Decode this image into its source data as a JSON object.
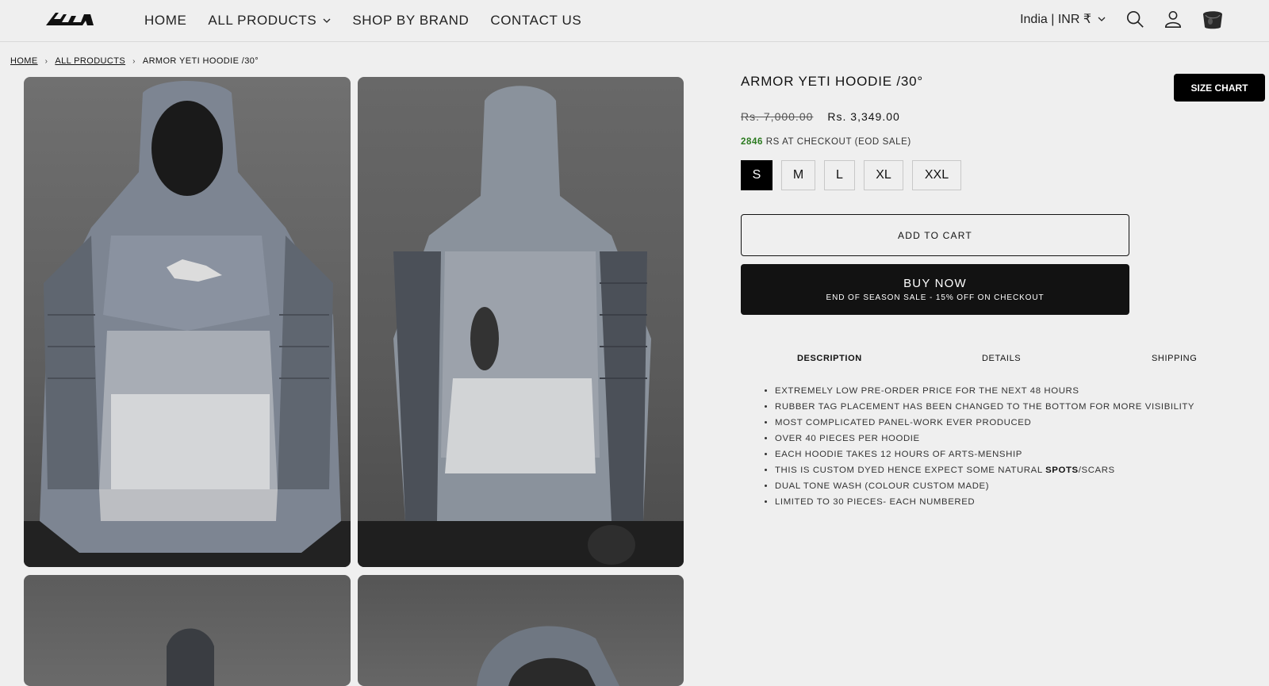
{
  "header": {
    "nav": [
      {
        "label": "HOME"
      },
      {
        "label": "ALL PRODUCTS",
        "has_dropdown": true
      },
      {
        "label": "SHOP BY BRAND"
      },
      {
        "label": "CONTACT US"
      }
    ],
    "locale": "India | INR ₹"
  },
  "breadcrumb": {
    "home": "HOME",
    "all_products": "ALL PRODUCTS",
    "current": "ARMOR YETI HOODIE /30°"
  },
  "product": {
    "title": "ARMOR YETI HOODIE /30°",
    "size_chart_label": "SIZE CHART",
    "price_old": "Rs. 7,000.00",
    "price_new": "Rs. 3,349.00",
    "checkout_amount": "2846",
    "checkout_note": " RS AT CHECKOUT (EOD SALE)",
    "sizes": [
      "S",
      "M",
      "L",
      "XL",
      "XXL"
    ],
    "selected_size": "S",
    "add_to_cart_label": "ADD TO CART",
    "buy_now_label": "BUY NOW",
    "buy_now_sub": "END OF SEASON SALE - 15% OFF ON CHECKOUT"
  },
  "tabs": [
    {
      "label": "DESCRIPTION",
      "active": true
    },
    {
      "label": "DETAILS",
      "active": false
    },
    {
      "label": "SHIPPING",
      "active": false
    }
  ],
  "description": [
    "EXTREMELY LOW PRE-ORDER PRICE FOR THE NEXT 48 HOURS",
    "RUBBER TAG PLACEMENT HAS BEEN CHANGED TO THE BOTTOM FOR MORE VISIBILITY",
    "MOST COMPLICATED PANEL-WORK EVER PRODUCED",
    "OVER 40 PIECES PER HOODIE",
    "EACH HOODIE TAKES 12 HOURS OF ARTS-MENSHIP",
    {
      "before": "THIS IS CUSTOM DYED HENCE EXPECT SOME NATURAL ",
      "bold": "SPOTS",
      "after": "/SCARS"
    },
    "DUAL TONE WASH (COLOUR CUSTOM MADE)",
    "LIMITED TO 30 PIECES- EACH NUMBERED"
  ],
  "colors": {
    "background": "#efefef",
    "primary": "#121212",
    "sale_green": "#2b7a1f"
  }
}
